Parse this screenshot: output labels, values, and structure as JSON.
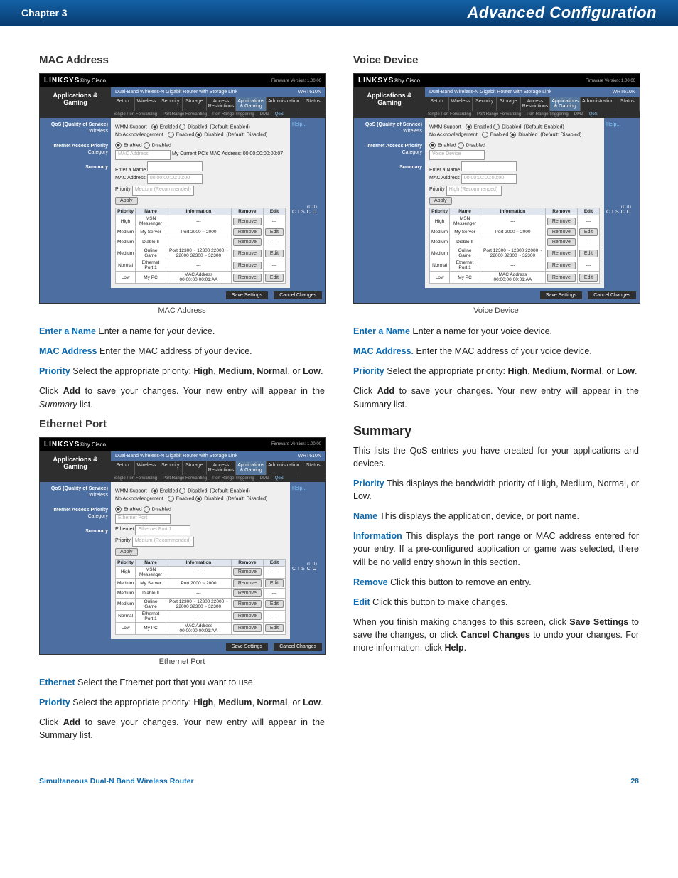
{
  "header": {
    "chapter": "Chapter 3",
    "title": "Advanced Configuration"
  },
  "footer": {
    "left": "Simultaneous Dual-N Band Wireless Router",
    "right": "28"
  },
  "left_col": {
    "mac_address": {
      "heading": "MAC Address",
      "caption": "MAC Address",
      "p1_term": "Enter a Name",
      "p1_text": "  Enter a name for your device.",
      "p2_term": "MAC Address",
      "p2_text": "  Enter the MAC address of your device.",
      "p3_term": "Priority",
      "p3_text_a": "  Select the appropriate priority: ",
      "p3_hi": "High",
      "p3_c1": ", ",
      "p3_med": "Medium",
      "p3_c2": ", ",
      "p3_norm": "Normal",
      "p3_c3": ", or ",
      "p3_low": "Low",
      "p3_end": ".",
      "p4_a": "Click ",
      "p4_add": "Add",
      "p4_b": " to save your changes. Your new entry will appear in the ",
      "p4_i": "Summary",
      "p4_c": " list."
    },
    "ethernet_port": {
      "heading": "Ethernet Port",
      "caption": "Ethernet Port",
      "p1_term": "Ethernet",
      "p1_text": "  Select the Ethernet port that you want to use.",
      "p2_term": "Priority",
      "p2_text_a": "   Select the appropriate priority: ",
      "p2_hi": "High",
      "p2_c1": ", ",
      "p2_med": "Medium",
      "p2_c2": ", ",
      "p2_norm": "Normal",
      "p2_c3": ", or ",
      "p2_low": "Low",
      "p2_end": ".",
      "p3_a": "Click ",
      "p3_add": "Add",
      "p3_b": " to save your changes. Your new entry will appear in the Summary list."
    }
  },
  "right_col": {
    "voice_device": {
      "heading": "Voice Device",
      "caption": "Voice Device",
      "p1_term": "Enter a Name",
      "p1_text": "  Enter a name for your voice device.",
      "p2_term": "MAC Address.",
      "p2_text": " Enter the MAC address of your voice device.",
      "p3_term": "Priority",
      "p3_text_a": "  Select the appropriate priority: ",
      "p3_hi": "High",
      "p3_c1": ", ",
      "p3_med": "Medium",
      "p3_c2": ", ",
      "p3_norm": "Normal",
      "p3_c3": ", or ",
      "p3_low": "Low",
      "p3_end": ".",
      "p4_a": "Click ",
      "p4_add": "Add",
      "p4_b": " to save your changes. Your new entry will appear in the Summary list."
    },
    "summary": {
      "heading": "Summary",
      "intro": "This lists the QoS entries you have created for your applications and devices.",
      "p_priority_term": "Priority",
      "p_priority_text": "  This displays the bandwidth priority of High, Medium, Normal, or Low.",
      "p_name_term": "Name",
      "p_name_text": " This displays the application, device, or port name.",
      "p_info_term": "Information",
      "p_info_text": "  This displays the port range or MAC address entered for your entry. If a pre-configured application or game was selected, there will be no valid entry shown in this section.",
      "p_remove_term": "Remove",
      "p_remove_text": "  Click this button to remove an entry.",
      "p_edit_term": "Edit",
      "p_edit_text": "  Click this button to make changes.",
      "closing_a": "When you finish making changes to this screen, click ",
      "closing_save": "Save Settings",
      "closing_b": " to save the changes, or click ",
      "closing_cancel": "Cancel Changes",
      "closing_c": " to undo your changes. For more information, click ",
      "closing_help": "Help",
      "closing_d": "."
    }
  },
  "shot": {
    "brand": "LINKSYS",
    "brand_sub": "®by Cisco",
    "firmware": "Firmware Version: 1.00.00",
    "router_title": "Dual-Band Wireless-N Gigabit Router with Storage Link",
    "model": "WRT610N",
    "nav_section": "Applications & Gaming",
    "tabs": [
      "Setup",
      "Wireless",
      "Security",
      "Storage",
      "Access Restrictions",
      "Applications & Gaming",
      "Administration",
      "Status"
    ],
    "subtabs": [
      "Single Port Forwarding",
      "Port Range Forwarding",
      "Port Range Triggering",
      "DMZ",
      "QoS"
    ],
    "help": "Help...",
    "sidebar": {
      "qos_h": "QoS (Quality of Service)",
      "wireless": "Wireless",
      "iap": "Internet Access Priority",
      "category": "Category",
      "summary": "Summary"
    },
    "content_mac": {
      "wmm_label": "WMM Support",
      "noack_label": "No Acknowledgement",
      "enabled": "Enabled",
      "disabled": "Disabled",
      "default_enabled": "(Default: Enabled)",
      "default_disabled": "(Default: Disabled)",
      "category_value": "MAC Address",
      "mac_desc": "My Current PC's MAC Address: 00:00:00:00:00:07",
      "enter_name_lbl": "Enter a Name",
      "mac_lbl": "MAC Address",
      "mac_placeholder": "00:00:00:00:00:00",
      "priority_lbl": "Priority",
      "priority_value": "Medium (Recommended)",
      "apply": "Apply"
    },
    "content_eth": {
      "category_value": "Ethernet Port",
      "eth_lbl": "Ethernet",
      "eth_value": "Ethernet Port 1",
      "priority_lbl": "Priority",
      "priority_value": "Medium (Recommended)",
      "apply": "Apply"
    },
    "content_voice": {
      "category_value": "Voice Device",
      "enter_name_lbl": "Enter a Name",
      "mac_lbl": "MAC Address",
      "mac_placeholder": "00:00:00:00:00:00",
      "priority_lbl": "Priority",
      "priority_value": "High (Recommended)",
      "apply": "Apply"
    },
    "summary_table": {
      "headers": [
        "Priority",
        "Name",
        "Information",
        "Remove",
        "Edit"
      ],
      "rows": [
        {
          "p": "High",
          "n": "MSN Messenger",
          "i": "---",
          "r": "Remove",
          "e": "---"
        },
        {
          "p": "Medium",
          "n": "My Server",
          "i": "Port 2000 ~ 2000",
          "r": "Remove",
          "e": "Edit"
        },
        {
          "p": "Medium",
          "n": "Diablo II",
          "i": "---",
          "r": "Remove",
          "e": "---"
        },
        {
          "p": "Medium",
          "n": "Online Game",
          "i": "Port 12300 ~ 12300 22000 ~ 22000 32300 ~ 32300",
          "r": "Remove",
          "e": "Edit"
        },
        {
          "p": "Normal",
          "n": "Ethernet Port 1",
          "i": "---",
          "r": "Remove",
          "e": "---"
        },
        {
          "p": "Low",
          "n": "My PC",
          "i": "MAC Address 00:00:00:00:01:AA",
          "r": "Remove",
          "e": "Edit"
        }
      ]
    },
    "save": "Save Settings",
    "cancel": "Cancel Changes",
    "cisco": "CISCO"
  }
}
